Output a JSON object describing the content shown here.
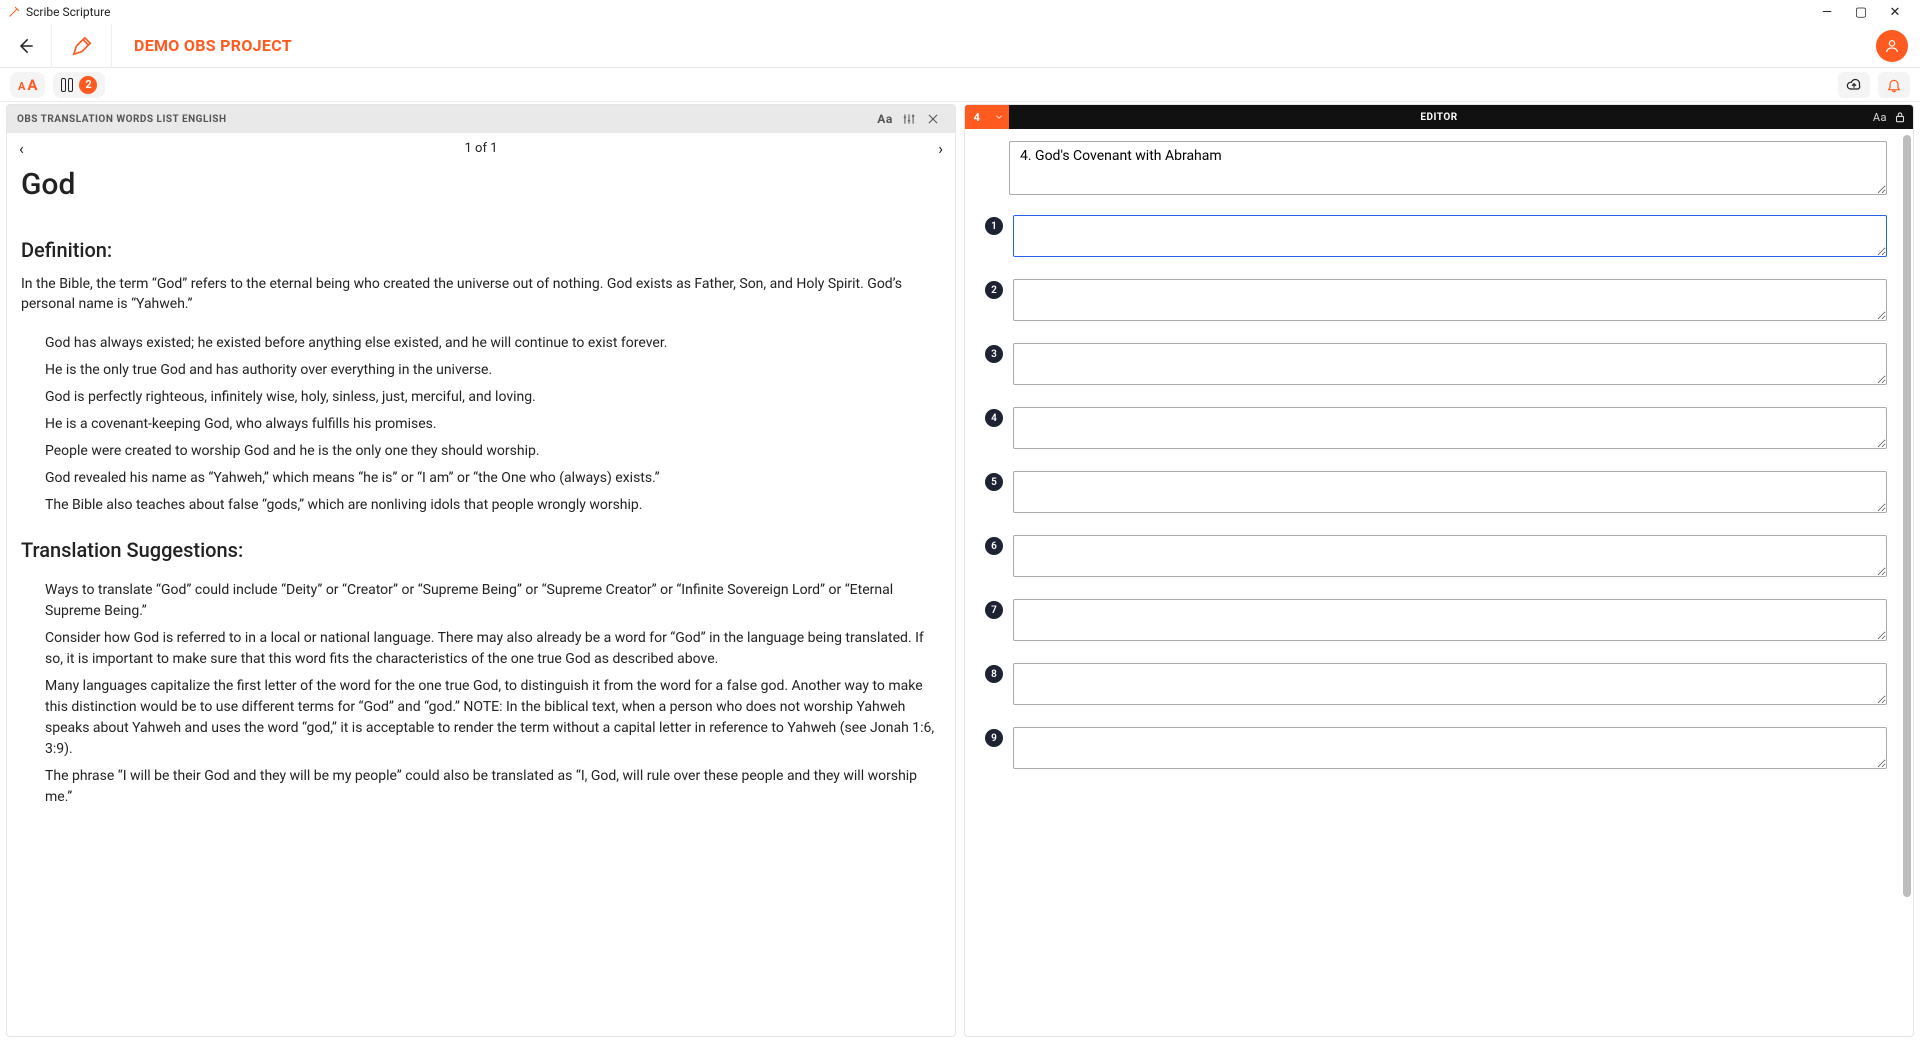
{
  "titlebar": {
    "app_name": "Scribe Scripture"
  },
  "header": {
    "project_title": "DEMO OBS PROJECT"
  },
  "toolbar": {
    "layout_badge": "2"
  },
  "left_pane": {
    "header_label": "OBS TRANSLATION WORDS LIST ENGLISH",
    "pager": "1 of 1",
    "h1": "God",
    "h2_def": "Definition:",
    "def_p1": "In the Bible, the term “God” refers to the eternal being who created the universe out of nothing. God exists as Father, Son, and Holy Spirit. God’s personal name is “Yahweh.”",
    "def_bullets": [
      "God has always existed; he existed before anything else existed, and he will continue to exist forever.",
      "He is the only true God and has authority over everything in the universe.",
      "God is perfectly righteous, infinitely wise, holy, sinless, just, merciful, and loving.",
      "He is a covenant-keeping God, who always fulfills his promises.",
      "People were created to worship God and he is the only one they should worship.",
      "God revealed his name as “Yahweh,” which means “he is” or “I am” or “the One who (always) exists.”",
      "The Bible also teaches about false “gods,” which are nonliving idols that people wrongly worship."
    ],
    "h2_sug": "Translation Suggestions:",
    "sug_bullets": [
      "Ways to translate “God” could include “Deity” or “Creator” or “Supreme Being” or “Supreme Creator” or “Infinite Sovereign Lord” or “Eternal Supreme Being.”",
      "Consider how God is referred to in a local or national language. There may also already be a word for “God” in the language being translated. If so, it is important to make sure that this word fits the characteristics of the one true God as described above.",
      "Many languages capitalize the first letter of the word for the one true God, to distinguish it from the word for a false god. Another way to make this distinction would be to use different terms for “God” and “god.” NOTE: In the biblical text, when a person who does not worship Yahweh speaks about Yahweh and uses the word “god,” it is acceptable to render the term without a capital letter in reference to Yahweh (see Jonah 1:6, 3:9).",
      "The phrase “I will be their God and they will be my people” could also be translated as “I, God, will rule over these people and they will worship me.”"
    ]
  },
  "right_pane": {
    "chapter": "4",
    "label": "EDITOR",
    "title_value": "4. God's Covenant with Abraham",
    "verses": [
      {
        "num": "1",
        "value": "",
        "active": true
      },
      {
        "num": "2",
        "value": ""
      },
      {
        "num": "3",
        "value": ""
      },
      {
        "num": "4",
        "value": ""
      },
      {
        "num": "5",
        "value": ""
      },
      {
        "num": "6",
        "value": ""
      },
      {
        "num": "7",
        "value": ""
      },
      {
        "num": "8",
        "value": ""
      },
      {
        "num": "9",
        "value": ""
      }
    ]
  }
}
